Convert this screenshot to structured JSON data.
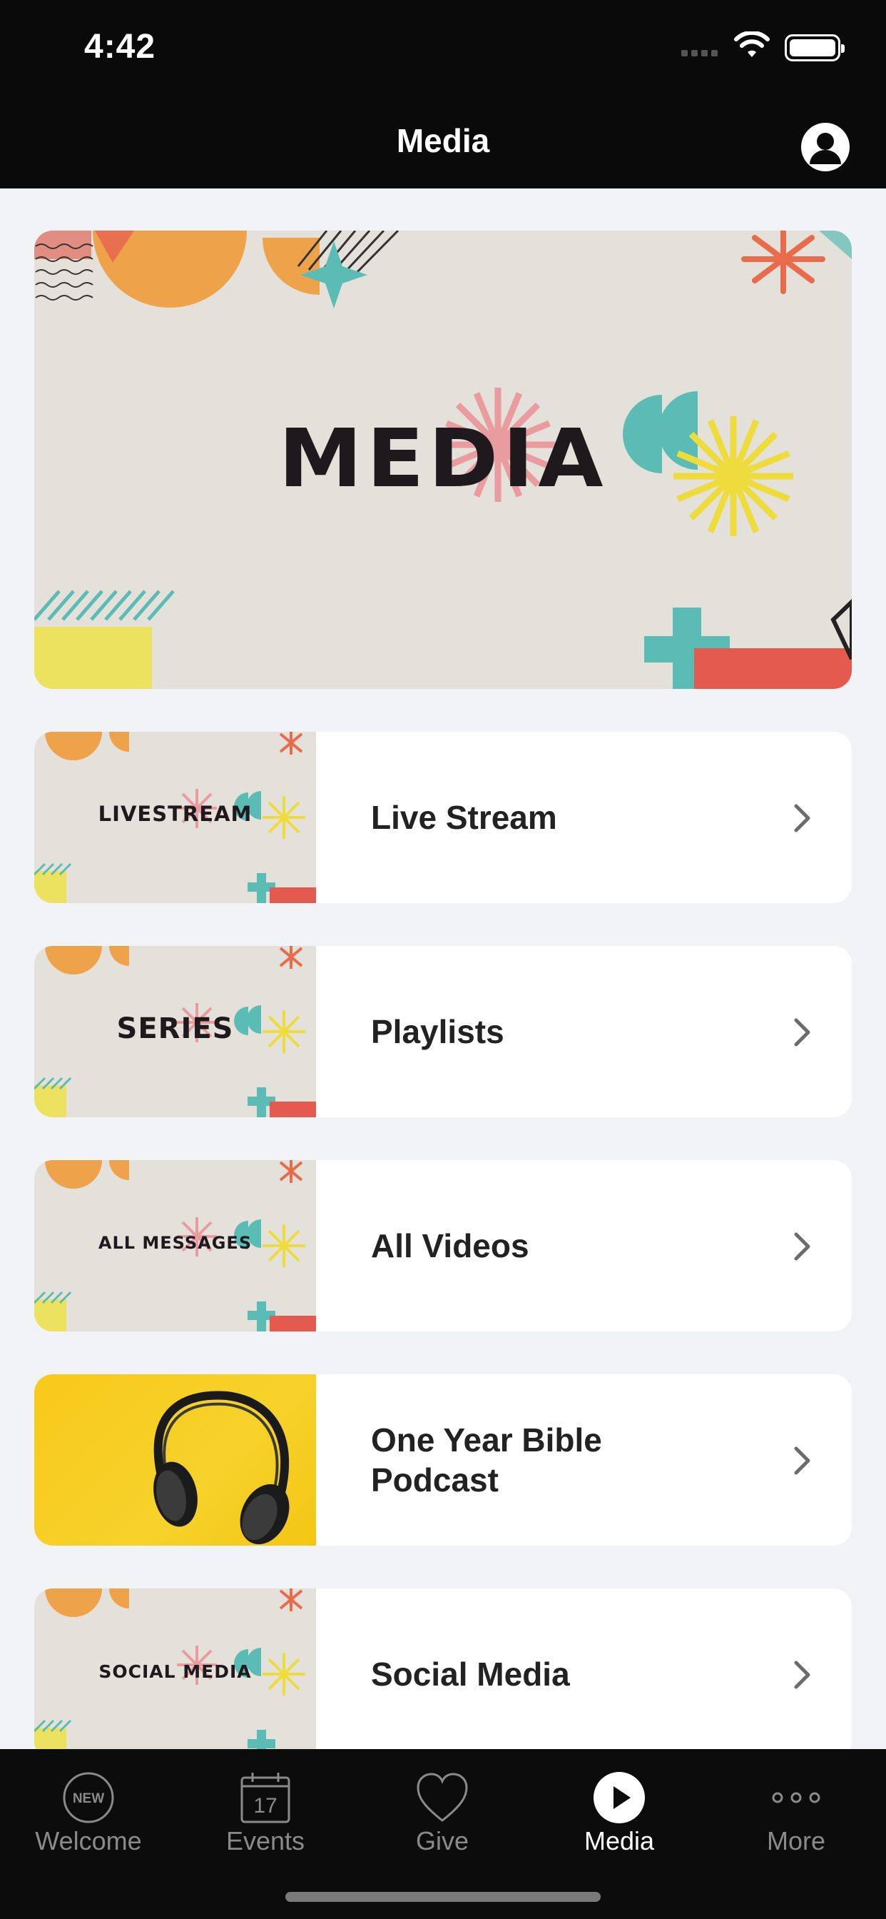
{
  "status_bar": {
    "time": "4:42"
  },
  "nav": {
    "title": "Media"
  },
  "hero": {
    "title": "MEDIA"
  },
  "items": [
    {
      "thumb_text": "LIVESTREAM",
      "label": "Live Stream"
    },
    {
      "thumb_text": "SERIES",
      "label": "Playlists"
    },
    {
      "thumb_text": "ALL MESSAGES",
      "label": "All Videos"
    },
    {
      "thumb_text": "",
      "label": "One Year Bible\nPodcast"
    },
    {
      "thumb_text": "SOCIAL MEDIA",
      "label": "Social Media"
    }
  ],
  "tabs": [
    {
      "label": "Welcome",
      "icon": "new-badge-icon",
      "badge": "NEW"
    },
    {
      "label": "Events",
      "icon": "calendar-icon",
      "day": "17"
    },
    {
      "label": "Give",
      "icon": "heart-icon"
    },
    {
      "label": "Media",
      "icon": "play-icon"
    },
    {
      "label": "More",
      "icon": "more-icon"
    }
  ],
  "colors": {
    "bar_bg": "#0a0a0a",
    "page_bg": "#f2f3f7",
    "accent": "#ffffff",
    "inactive": "#8a8a8a"
  }
}
